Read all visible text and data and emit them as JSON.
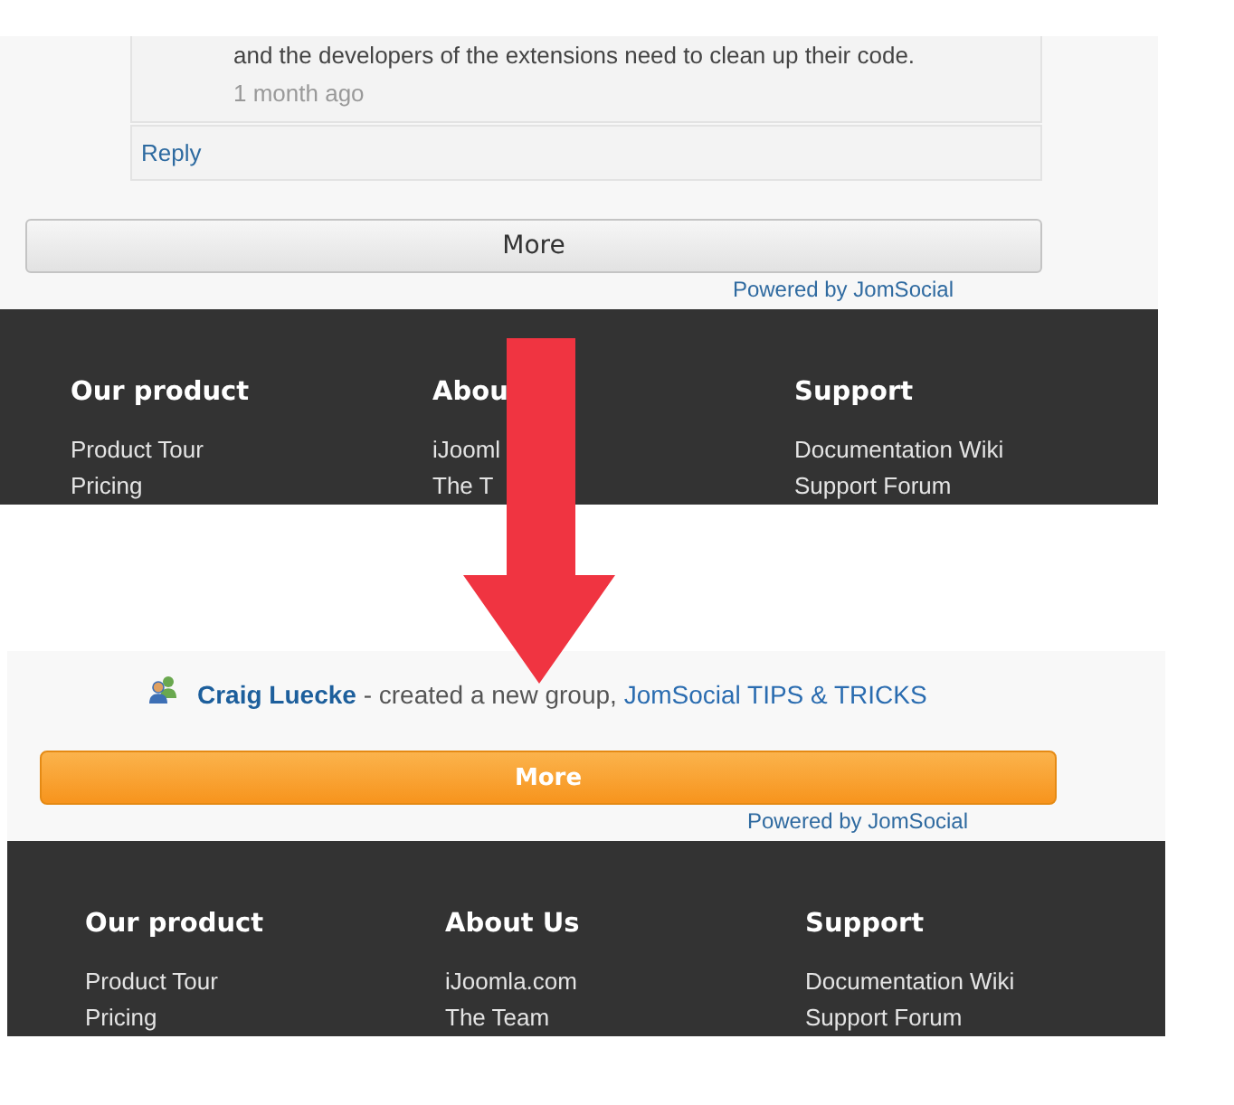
{
  "top_screenshot": {
    "comment": {
      "text": "and the developers of the extensions need to clean up their code.",
      "time": "1 month ago"
    },
    "reply_link": "Reply",
    "more_button": {
      "label": "More",
      "kind": "plain"
    },
    "powered_by": "Powered by JomSocial",
    "footer": [
      {
        "heading": "Our product",
        "links": [
          "Product Tour",
          "Pricing"
        ]
      },
      {
        "heading": "Abou",
        "links": [
          "iJooml",
          "The T"
        ]
      },
      {
        "heading": "Support",
        "links": [
          "Documentation Wiki",
          "Support Forum"
        ]
      }
    ]
  },
  "bottom_screenshot": {
    "activity": {
      "actor": "Craig Luecke",
      "action": "- created a new group,",
      "target": "JomSocial TIPS & TRICKS"
    },
    "more_button": {
      "label": "More",
      "kind": "primary"
    },
    "powered_by": "Powered by JomSocial",
    "footer": [
      {
        "heading": "Our product",
        "links": [
          "Product Tour",
          "Pricing"
        ]
      },
      {
        "heading": "About Us",
        "links": [
          "iJoomla.com",
          "The Team"
        ]
      },
      {
        "heading": "Support",
        "links": [
          "Documentation Wiki",
          "Support Forum"
        ]
      }
    ]
  }
}
